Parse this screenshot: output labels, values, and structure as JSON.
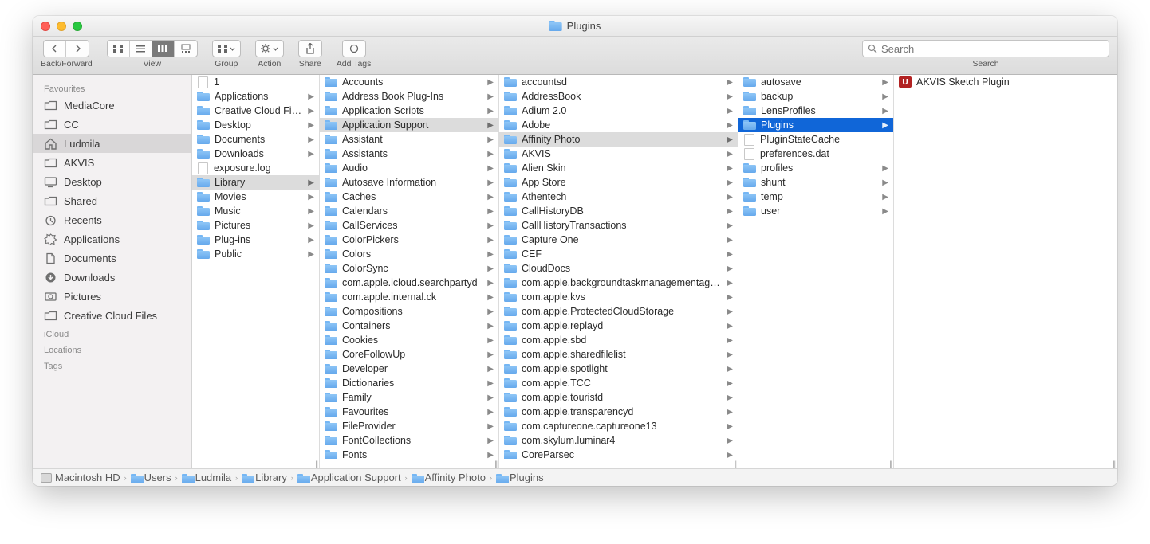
{
  "title": "Plugins",
  "toolbar": {
    "back_forward_label": "Back/Forward",
    "view_label": "View",
    "group_label": "Group",
    "action_label": "Action",
    "share_label": "Share",
    "add_tags_label": "Add Tags",
    "search_label": "Search",
    "search_placeholder": "Search"
  },
  "sidebar": {
    "sections": [
      {
        "header": "Favourites",
        "items": [
          {
            "label": "MediaCore",
            "icon": "folder"
          },
          {
            "label": "CC",
            "icon": "folder"
          },
          {
            "label": "Ludmila",
            "icon": "home",
            "selected": true
          },
          {
            "label": "AKVIS",
            "icon": "folder"
          },
          {
            "label": "Desktop",
            "icon": "desktop"
          },
          {
            "label": "Shared",
            "icon": "folder"
          },
          {
            "label": "Recents",
            "icon": "recents"
          },
          {
            "label": "Applications",
            "icon": "apps"
          },
          {
            "label": "Documents",
            "icon": "documents"
          },
          {
            "label": "Downloads",
            "icon": "downloads"
          },
          {
            "label": "Pictures",
            "icon": "pictures"
          },
          {
            "label": "Creative Cloud Files",
            "icon": "folder"
          }
        ]
      },
      {
        "header": "iCloud",
        "items": []
      },
      {
        "header": "Locations",
        "items": []
      },
      {
        "header": "Tags",
        "items": []
      }
    ]
  },
  "columns": [
    {
      "width": "col1",
      "items": [
        {
          "label": "1",
          "type": "file"
        },
        {
          "label": "Applications",
          "type": "folder",
          "children": true
        },
        {
          "label": "Creative Cloud Files",
          "type": "folder",
          "children": true
        },
        {
          "label": "Desktop",
          "type": "folder",
          "children": true
        },
        {
          "label": "Documents",
          "type": "folder",
          "children": true
        },
        {
          "label": "Downloads",
          "type": "folder",
          "children": true
        },
        {
          "label": "exposure.log",
          "type": "file"
        },
        {
          "label": "Library",
          "type": "folder",
          "children": true,
          "path": true
        },
        {
          "label": "Movies",
          "type": "folder",
          "children": true
        },
        {
          "label": "Music",
          "type": "folder",
          "children": true
        },
        {
          "label": "Pictures",
          "type": "folder",
          "children": true
        },
        {
          "label": "Plug-ins",
          "type": "folder",
          "children": true
        },
        {
          "label": "Public",
          "type": "folder",
          "children": true
        }
      ]
    },
    {
      "width": "col2",
      "items": [
        {
          "label": "Accounts",
          "type": "folder",
          "children": true
        },
        {
          "label": "Address Book Plug-Ins",
          "type": "folder",
          "children": true
        },
        {
          "label": "Application Scripts",
          "type": "folder",
          "children": true
        },
        {
          "label": "Application Support",
          "type": "folder",
          "children": true,
          "path": true
        },
        {
          "label": "Assistant",
          "type": "folder",
          "children": true
        },
        {
          "label": "Assistants",
          "type": "folder",
          "children": true
        },
        {
          "label": "Audio",
          "type": "folder",
          "children": true
        },
        {
          "label": "Autosave Information",
          "type": "folder",
          "children": true
        },
        {
          "label": "Caches",
          "type": "folder",
          "children": true
        },
        {
          "label": "Calendars",
          "type": "folder",
          "children": true
        },
        {
          "label": "CallServices",
          "type": "folder",
          "children": true
        },
        {
          "label": "ColorPickers",
          "type": "folder",
          "children": true
        },
        {
          "label": "Colors",
          "type": "folder",
          "children": true
        },
        {
          "label": "ColorSync",
          "type": "folder",
          "children": true
        },
        {
          "label": "com.apple.icloud.searchpartyd",
          "type": "folder",
          "children": true
        },
        {
          "label": "com.apple.internal.ck",
          "type": "folder",
          "children": true
        },
        {
          "label": "Compositions",
          "type": "folder",
          "children": true
        },
        {
          "label": "Containers",
          "type": "folder",
          "children": true
        },
        {
          "label": "Cookies",
          "type": "folder",
          "children": true
        },
        {
          "label": "CoreFollowUp",
          "type": "folder",
          "children": true
        },
        {
          "label": "Developer",
          "type": "folder",
          "children": true
        },
        {
          "label": "Dictionaries",
          "type": "folder",
          "children": true
        },
        {
          "label": "Family",
          "type": "folder",
          "children": true
        },
        {
          "label": "Favourites",
          "type": "folder",
          "children": true
        },
        {
          "label": "FileProvider",
          "type": "folder",
          "children": true
        },
        {
          "label": "FontCollections",
          "type": "folder",
          "children": true
        },
        {
          "label": "Fonts",
          "type": "folder",
          "children": true
        }
      ]
    },
    {
      "width": "col3",
      "items": [
        {
          "label": "accountsd",
          "type": "folder",
          "children": true
        },
        {
          "label": "AddressBook",
          "type": "folder",
          "children": true
        },
        {
          "label": "Adium 2.0",
          "type": "folder",
          "children": true
        },
        {
          "label": "Adobe",
          "type": "folder",
          "children": true
        },
        {
          "label": "Affinity Photo",
          "type": "folder",
          "children": true,
          "path": true
        },
        {
          "label": "AKVIS",
          "type": "folder",
          "children": true
        },
        {
          "label": "Alien Skin",
          "type": "folder",
          "children": true
        },
        {
          "label": "App Store",
          "type": "folder",
          "children": true
        },
        {
          "label": "Athentech",
          "type": "folder",
          "children": true
        },
        {
          "label": "CallHistoryDB",
          "type": "folder",
          "children": true
        },
        {
          "label": "CallHistoryTransactions",
          "type": "folder",
          "children": true
        },
        {
          "label": "Capture One",
          "type": "folder",
          "children": true
        },
        {
          "label": "CEF",
          "type": "folder",
          "children": true
        },
        {
          "label": "CloudDocs",
          "type": "folder",
          "children": true
        },
        {
          "label": "com.apple.backgroundtaskmanagementagent",
          "type": "folder",
          "children": true
        },
        {
          "label": "com.apple.kvs",
          "type": "folder",
          "children": true
        },
        {
          "label": "com.apple.ProtectedCloudStorage",
          "type": "folder",
          "children": true
        },
        {
          "label": "com.apple.replayd",
          "type": "folder",
          "children": true
        },
        {
          "label": "com.apple.sbd",
          "type": "folder",
          "children": true
        },
        {
          "label": "com.apple.sharedfilelist",
          "type": "folder",
          "children": true
        },
        {
          "label": "com.apple.spotlight",
          "type": "folder",
          "children": true
        },
        {
          "label": "com.apple.TCC",
          "type": "folder",
          "children": true
        },
        {
          "label": "com.apple.touristd",
          "type": "folder",
          "children": true
        },
        {
          "label": "com.apple.transparencyd",
          "type": "folder",
          "children": true
        },
        {
          "label": "com.captureone.captureone13",
          "type": "folder",
          "children": true
        },
        {
          "label": "com.skylum.luminar4",
          "type": "folder",
          "children": true
        },
        {
          "label": "CoreParsec",
          "type": "folder",
          "children": true
        }
      ]
    },
    {
      "width": "col4",
      "items": [
        {
          "label": "autosave",
          "type": "folder",
          "children": true
        },
        {
          "label": "backup",
          "type": "folder",
          "children": true
        },
        {
          "label": "LensProfiles",
          "type": "folder",
          "children": true
        },
        {
          "label": "Plugins",
          "type": "folder",
          "children": true,
          "selected": true
        },
        {
          "label": "PluginStateCache",
          "type": "file"
        },
        {
          "label": "preferences.dat",
          "type": "file"
        },
        {
          "label": "profiles",
          "type": "folder",
          "children": true
        },
        {
          "label": "shunt",
          "type": "folder",
          "children": true
        },
        {
          "label": "temp",
          "type": "folder",
          "children": true
        },
        {
          "label": "user",
          "type": "folder",
          "children": true
        }
      ]
    },
    {
      "width": "col5",
      "items": [
        {
          "label": "AKVIS Sketch Plugin",
          "type": "app"
        }
      ]
    }
  ],
  "pathbar": [
    {
      "label": "Macintosh HD",
      "icon": "hd"
    },
    {
      "label": "Users",
      "icon": "folder"
    },
    {
      "label": "Ludmila",
      "icon": "folder"
    },
    {
      "label": "Library",
      "icon": "folder"
    },
    {
      "label": "Application Support",
      "icon": "folder"
    },
    {
      "label": "Affinity Photo",
      "icon": "folder"
    },
    {
      "label": "Plugins",
      "icon": "folder"
    }
  ]
}
